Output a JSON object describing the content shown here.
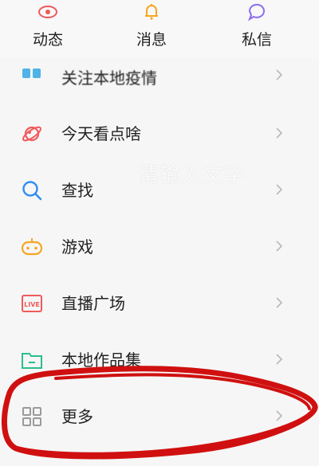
{
  "topnav": {
    "tabs": [
      {
        "label": "动态",
        "icon": "eye-icon"
      },
      {
        "label": "消息",
        "icon": "bell-icon"
      },
      {
        "label": "私信",
        "icon": "chat-bubble-icon"
      }
    ]
  },
  "menu": {
    "items": [
      {
        "label": "关注本地疫情",
        "icon": "local-icon",
        "partial": true
      },
      {
        "label": "今天看点啥",
        "icon": "planet-icon"
      },
      {
        "label": "查找",
        "icon": "search-icon"
      },
      {
        "label": "游戏",
        "icon": "gamepad-icon"
      },
      {
        "label": "直播广场",
        "icon": "live-icon",
        "badge": "LIVE"
      },
      {
        "label": "本地作品集",
        "icon": "folder-icon"
      },
      {
        "label": "更多",
        "icon": "grid-icon"
      }
    ]
  },
  "watermark": "请输入文字",
  "colors": {
    "eye": "#f05a5a",
    "bell": "#f5a623",
    "chat": "#8b6cf0",
    "planet": "#f05a5a",
    "search": "#2f8ff0",
    "game": "#f5a623",
    "live": "#f05a5a",
    "folder": "#2bbf8a",
    "grid": "#9a9a9a",
    "annotation": "#d01010"
  }
}
